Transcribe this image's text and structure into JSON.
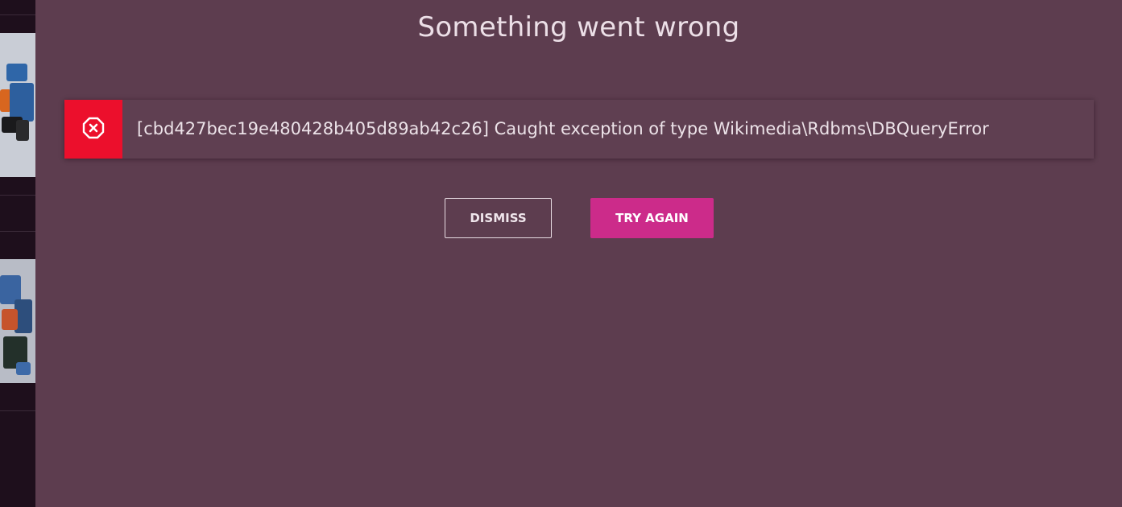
{
  "modal": {
    "title": "Something went wrong",
    "error": {
      "icon": "error-circle-x-icon",
      "message": "[cbd427bec19e480428b405d89ab42c26] Caught exception of type Wikimedia\\Rdbms\\DBQueryError"
    },
    "buttons": {
      "dismiss_label": "DISMISS",
      "try_again_label": "TRY AGAIN"
    }
  },
  "colors": {
    "overlay": "#5d3d4f",
    "error_accent": "#ec0f2c",
    "primary_button": "#cc2b8a"
  }
}
